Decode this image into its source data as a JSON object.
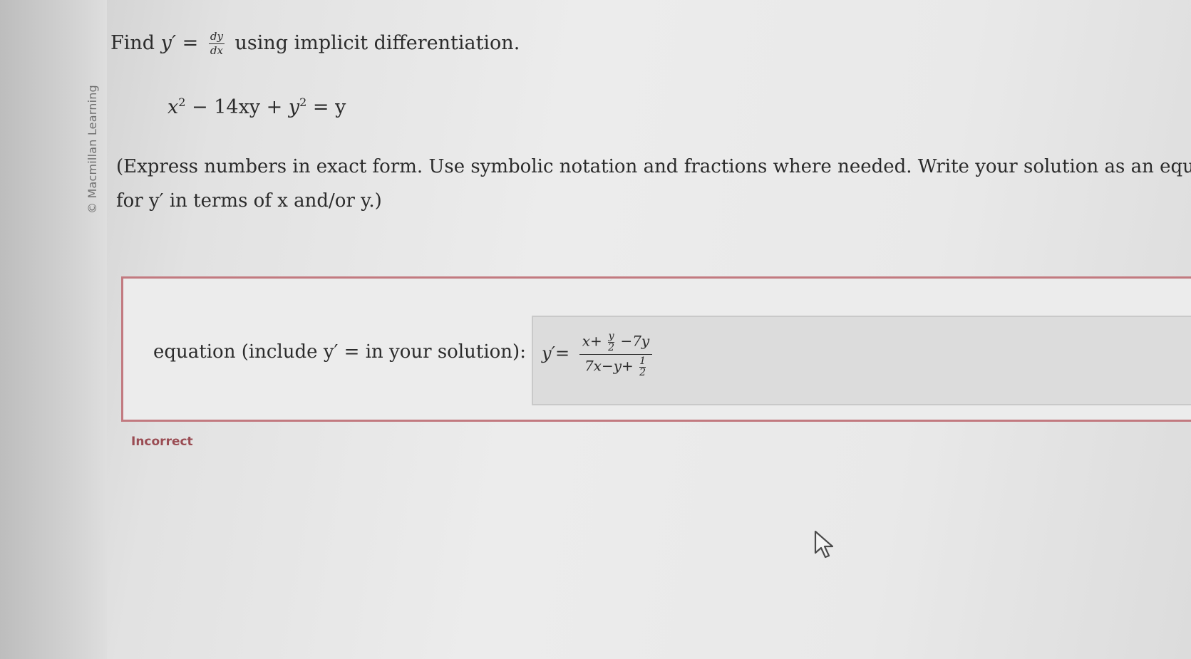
{
  "copyright": "© Macmillan Learning",
  "question": {
    "prefix": "Find",
    "yprime": "y′",
    "equals": "=",
    "frac_num": "dy",
    "frac_den": "dx",
    "suffix": "using implicit differentiation."
  },
  "equation": {
    "text_html_free": "x² − 14xy + y² = y",
    "parts": [
      "x",
      "2",
      " − 14xy + ",
      "y",
      "2",
      " = y"
    ]
  },
  "instructions": {
    "line1": "(Express numbers in exact form. Use symbolic notation and fractions where needed. Write your solution as an equatior",
    "line2": "for y′ in terms of x and/or y.)"
  },
  "answer": {
    "label": "equation (include y′ = in your solution):",
    "lhs": "y′=",
    "num_a": "x+",
    "num_frac_top": "y",
    "num_frac_bottom": "2",
    "num_b": "−7y",
    "den_a": "7x−y+",
    "den_frac_top": "1",
    "den_frac_bottom": "2"
  },
  "feedback": {
    "status": "Incorrect",
    "color": "#9a4c53"
  },
  "colors": {
    "error_border": "#c27a80",
    "input_bg": "#dcdcdc"
  },
  "icons": {
    "cursor": "mouse-pointer-icon"
  }
}
